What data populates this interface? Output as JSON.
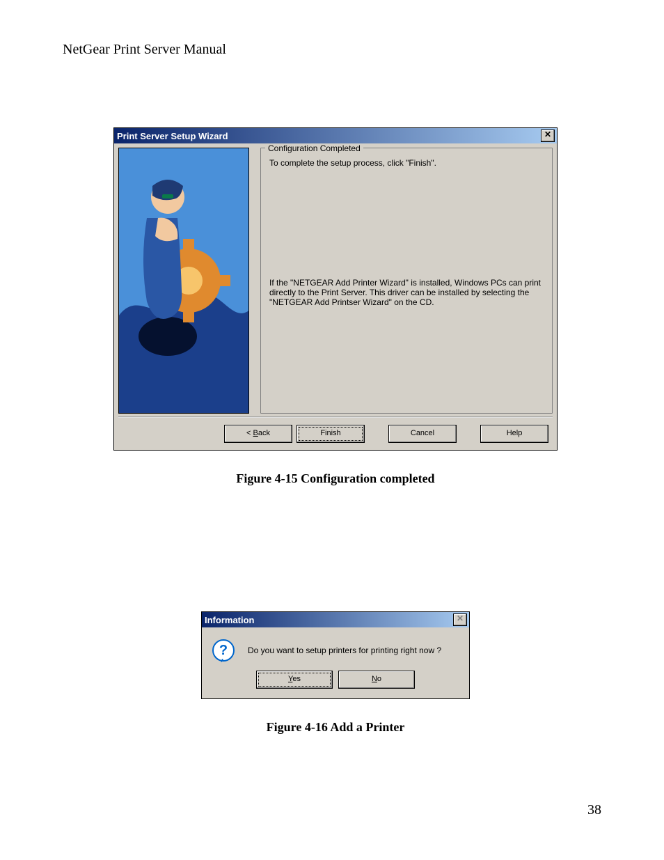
{
  "page": {
    "running_head": "NetGear Print Server Manual",
    "page_number": "38"
  },
  "dialog1": {
    "title": "Print Server Setup Wizard",
    "close_glyph": "✕",
    "group_label": "Configuration Completed",
    "line1": "To complete the setup process, click \"Finish\".",
    "line2": "If the \"NETGEAR Add Printer Wizard\" is installed, Windows PCs can print directly to the Print Server. This driver can be installed by selecting the \"NETGEAR Add Printser Wizard\" on the CD.",
    "buttons": {
      "back_prefix": "< ",
      "back_u": "B",
      "back_suffix": "ack",
      "finish": "Finish",
      "cancel": "Cancel",
      "help": "Help"
    }
  },
  "caption1": "Figure 4-15 Configuration completed",
  "dialog2": {
    "title": "Information",
    "close_glyph": "✕",
    "message": "Do you want to setup printers for printing right now ?",
    "buttons": {
      "yes_u": "Y",
      "yes_suffix": "es",
      "no_u": "N",
      "no_suffix": "o"
    }
  },
  "caption2": "Figure 4-16 Add a Printer"
}
